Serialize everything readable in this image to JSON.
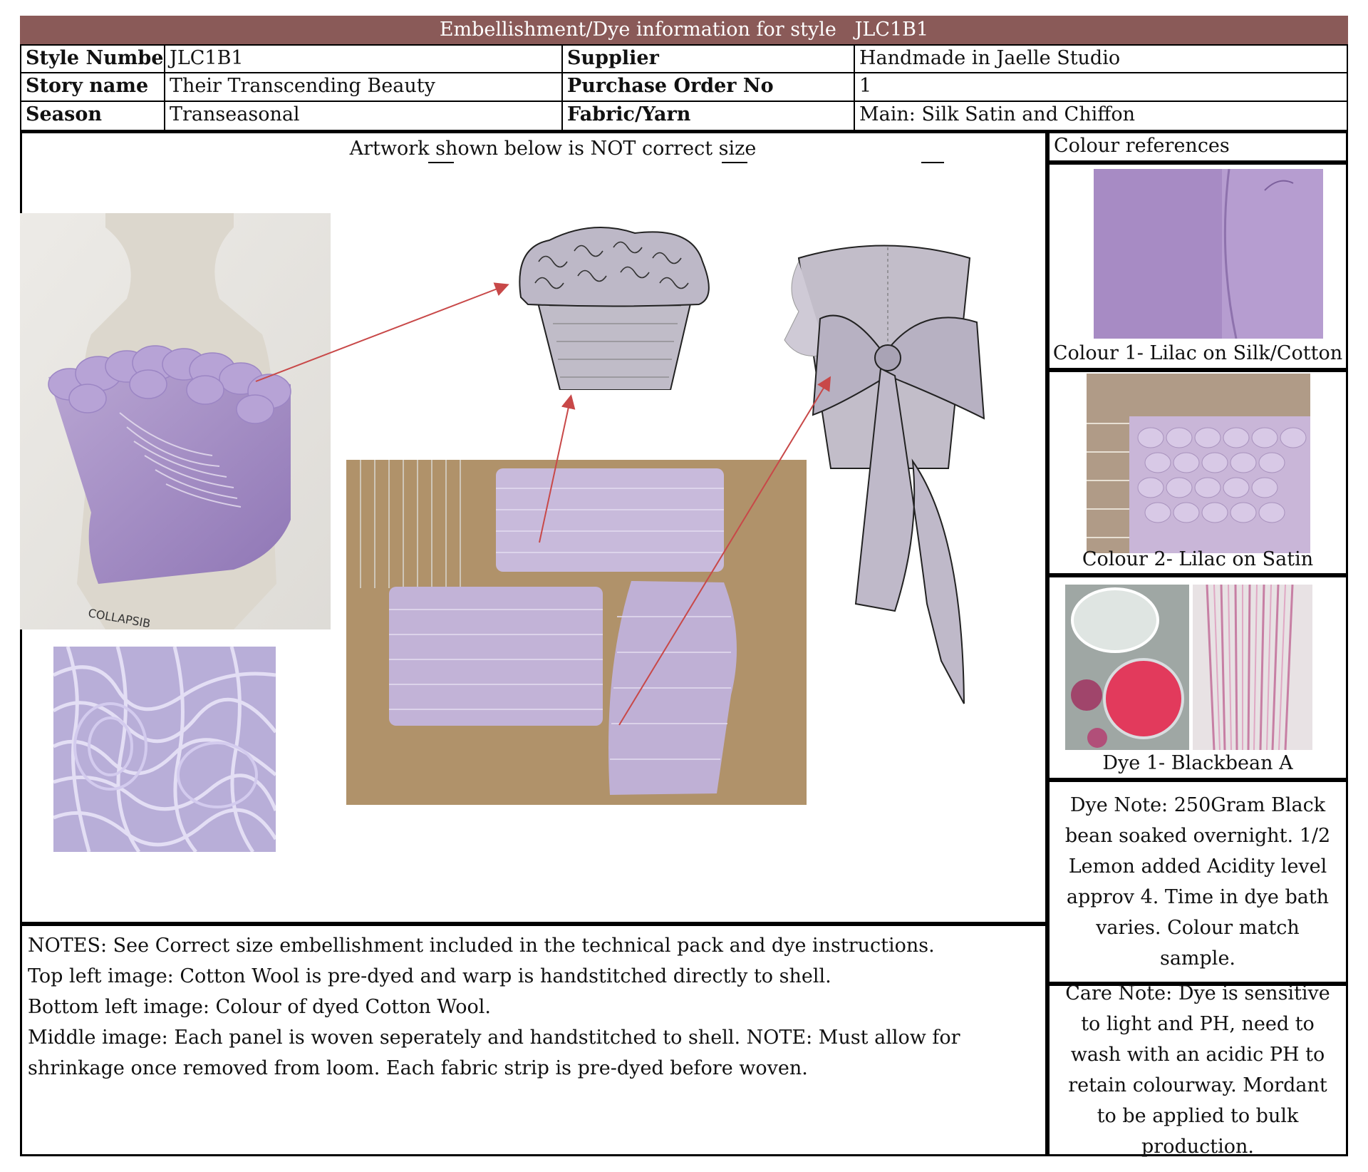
{
  "title": "Embellishment/Dye information for style   JLC1B1",
  "header": {
    "row1": {
      "label1": "Style Number",
      "value1": "JLC1B1",
      "label2": "Supplier",
      "value2": "Handmade in Jaelle Studio"
    },
    "row2": {
      "label1": "Story name",
      "value1": "Their Transcending Beauty",
      "label2": "Purchase Order No",
      "value2": "1"
    },
    "row3": {
      "label1": "Season",
      "value1": "Transeasonal",
      "label2": "Fabric/Yarn",
      "value2": "Main: Silk Satin and Chiffon"
    }
  },
  "artwork_note": "Artwork shown below is NOT correct size",
  "colour_refs": {
    "heading": "Colour references",
    "colour1": "Colour 1- Lilac on Silk/Cotton",
    "colour2": "Colour 2- Lilac on Satin",
    "dye1": "Dye 1- Blackbean A"
  },
  "dye_note": "Dye Note: 250Gram Black bean soaked overnight. 1/2 Lemon added Acidity level approv 4. Time in dye bath varies. Colour match sample.",
  "care_note": "Care Note: Dye is sensitive to light and PH, need to wash with an acidic PH to retain colourway. Mordant to be applied to bulk production.",
  "notes": [
    "NOTES: See Correct size embellishment included in the technical pack and dye instructions.",
    "Top left image: Cotton Wool is pre-dyed and warp is handstitched directly to shell.",
    "Bottom left image: Colour of dyed Cotton Wool.",
    "Middle image: Each panel is woven seperately and handstitched to shell. NOTE: Must allow for shrinkage once removed from loom. Each fabric strip is pre-dyed before woven."
  ],
  "images": {
    "mannequin": "mannequin-photo",
    "yarn": "yarn-photo",
    "loom": "woven-panels-photo",
    "front_sketch": "front-sketch",
    "back_sketch": "back-sketch",
    "swatch1": "silk-swatch",
    "swatch2": "satin-swatch",
    "dye_bowl": "dye-bowl-photo",
    "dyed_strips": "dyed-strips-photo"
  },
  "colors": {
    "title_bar": "#8a5a58",
    "lilac": "#a58cc8",
    "arrow": "#c84848"
  }
}
